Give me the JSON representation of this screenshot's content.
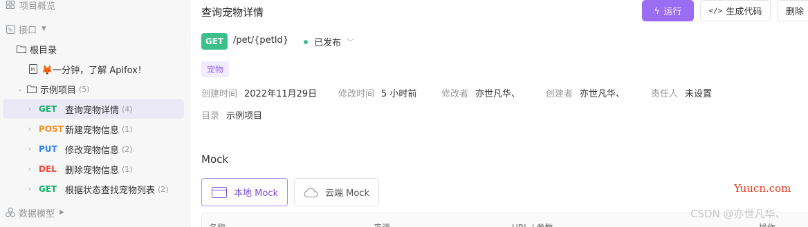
{
  "sidebar": {
    "overview_label": "项目概览",
    "api_label": "接口",
    "root_folder": "根目录",
    "intro_doc": "🦊一分钟，了解 Apifox！",
    "example_folder": "示例项目",
    "example_count": "(5)",
    "endpoints": [
      {
        "method": "GET",
        "name": "查询宠物详情",
        "count": "(4)"
      },
      {
        "method": "POST",
        "name": "新建宠物信息",
        "count": "(1)"
      },
      {
        "method": "PUT",
        "name": "修改宠物信息",
        "count": "(2)"
      },
      {
        "method": "DEL",
        "name": "删除宠物信息",
        "count": "(1)"
      },
      {
        "method": "GET",
        "name": "根据状态查找宠物列表",
        "count": "(2)"
      }
    ],
    "data_model_label": "数据模型"
  },
  "main": {
    "title": "查询宠物详情",
    "run_button": "运行",
    "gen_code_button": "生成代码",
    "delete_button": "删除",
    "method": "GET",
    "path": "/pet/{petId}",
    "status": "已发布",
    "tag": "宠物",
    "meta": {
      "created_label": "创建时间",
      "created_value": "2022年11月29日",
      "modified_label": "修改时间",
      "modified_value": "5 小时前",
      "modifier_label": "修改者",
      "modifier_value": "亦世凡华、",
      "creator_label": "创建者",
      "creator_value": "亦世凡华、",
      "owner_label": "责任人",
      "owner_value": "未设置",
      "folder_label": "目录",
      "folder_value": "示例项目"
    },
    "mock_title": "Mock",
    "mock_local": "本地 Mock",
    "mock_cloud": "云端 Mock",
    "table_headers": [
      "名称",
      "来源",
      "URL / 参数",
      "操作"
    ]
  },
  "watermark": {
    "site": "Yuucn.com",
    "author": "CSDN @亦世凡华、"
  },
  "colors": {
    "accent": "#9b6df2",
    "get": "#17b26a",
    "post": "#f7901e",
    "put": "#2f80ed",
    "del": "#f04438"
  }
}
